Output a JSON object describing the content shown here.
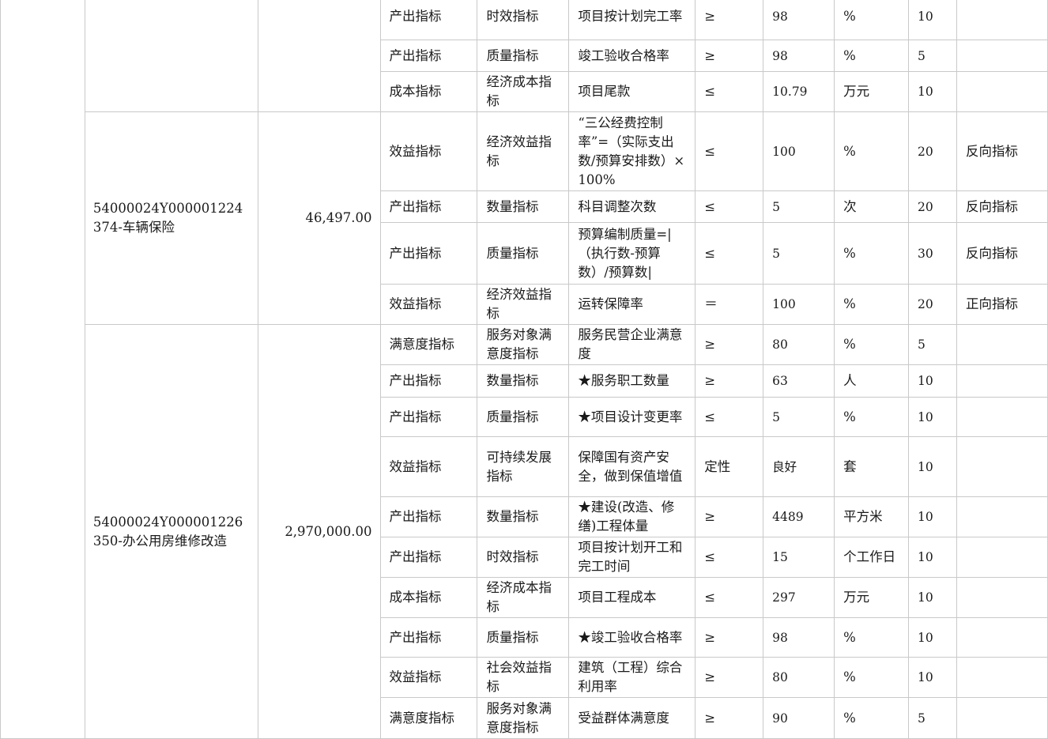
{
  "groups": [
    {
      "project": "",
      "amount": "",
      "rows": [
        {
          "c1": "产出指标",
          "c2": "时效指标",
          "c3": "项目按计划完工率",
          "op": "≥",
          "val": "98",
          "unit": "%",
          "wt": "10",
          "dir": ""
        },
        {
          "c1": "产出指标",
          "c2": "质量指标",
          "c3": "竣工验收合格率",
          "op": "≥",
          "val": "98",
          "unit": "%",
          "wt": "5",
          "dir": ""
        },
        {
          "c1": "成本指标",
          "c2": "经济成本指标",
          "c3": "项目尾款",
          "op": "≤",
          "val": "10.79",
          "unit": "万元",
          "wt": "10",
          "dir": ""
        }
      ]
    },
    {
      "project": "54000024Y000001224374-车辆保险",
      "amount": "46,497.00",
      "rows": [
        {
          "c1": "效益指标",
          "c2": "经济效益指标",
          "c3": "“三公经费控制率”=（实际支出数/预算安排数）×100%",
          "op": "≤",
          "val": "100",
          "unit": "%",
          "wt": "20",
          "dir": "反向指标"
        },
        {
          "c1": "产出指标",
          "c2": "数量指标",
          "c3": "科目调整次数",
          "op": "≤",
          "val": "5",
          "unit": "次",
          "wt": "20",
          "dir": "反向指标"
        },
        {
          "c1": "产出指标",
          "c2": "质量指标",
          "c3": "预算编制质量=|（执行数-预算数）/预算数|",
          "op": "≤",
          "val": "5",
          "unit": "%",
          "wt": "30",
          "dir": "反向指标"
        },
        {
          "c1": "效益指标",
          "c2": "经济效益指标",
          "c3": "运转保障率",
          "op": "＝",
          "val": "100",
          "unit": "%",
          "wt": "20",
          "dir": "正向指标"
        }
      ]
    },
    {
      "project": "54000024Y000001226350-办公用房维修改造",
      "amount": "2,970,000.00",
      "rows": [
        {
          "c1": "满意度指标",
          "c2": "服务对象满意度指标",
          "c3": "服务民营企业满意度",
          "op": "≥",
          "val": "80",
          "unit": "%",
          "wt": "5",
          "dir": ""
        },
        {
          "c1": "产出指标",
          "c2": "数量指标",
          "c3": "★服务职工数量",
          "op": "≥",
          "val": "63",
          "unit": "人",
          "wt": "10",
          "dir": ""
        },
        {
          "c1": "产出指标",
          "c2": "质量指标",
          "c3": "★项目设计变更率",
          "op": "≤",
          "val": "5",
          "unit": "%",
          "wt": "10",
          "dir": ""
        },
        {
          "c1": "效益指标",
          "c2": "可持续发展指标",
          "c3": "保障国有资产安全，做到保值增值",
          "op": "定性",
          "val": "良好",
          "unit": "套",
          "wt": "10",
          "dir": ""
        },
        {
          "c1": "产出指标",
          "c2": "数量指标",
          "c3": "★建设(改造、修缮)工程体量",
          "op": "≥",
          "val": "4489",
          "unit": "平方米",
          "wt": "10",
          "dir": ""
        },
        {
          "c1": "产出指标",
          "c2": "时效指标",
          "c3": "项目按计划开工和完工时间",
          "op": "≤",
          "val": "15",
          "unit": "个工作日",
          "wt": "10",
          "dir": ""
        },
        {
          "c1": "成本指标",
          "c2": "经济成本指标",
          "c3": "项目工程成本",
          "op": "≤",
          "val": "297",
          "unit": "万元",
          "wt": "10",
          "dir": ""
        },
        {
          "c1": "产出指标",
          "c2": "质量指标",
          "c3": "★竣工验收合格率",
          "op": "≥",
          "val": "98",
          "unit": "%",
          "wt": "10",
          "dir": ""
        },
        {
          "c1": "效益指标",
          "c2": "社会效益指标",
          "c3": "建筑（工程）综合利用率",
          "op": "≥",
          "val": "80",
          "unit": "%",
          "wt": "10",
          "dir": ""
        },
        {
          "c1": "满意度指标",
          "c2": "服务对象满意度指标",
          "c3": "受益群体满意度",
          "op": "≥",
          "val": "90",
          "unit": "%",
          "wt": "5",
          "dir": ""
        }
      ]
    }
  ]
}
